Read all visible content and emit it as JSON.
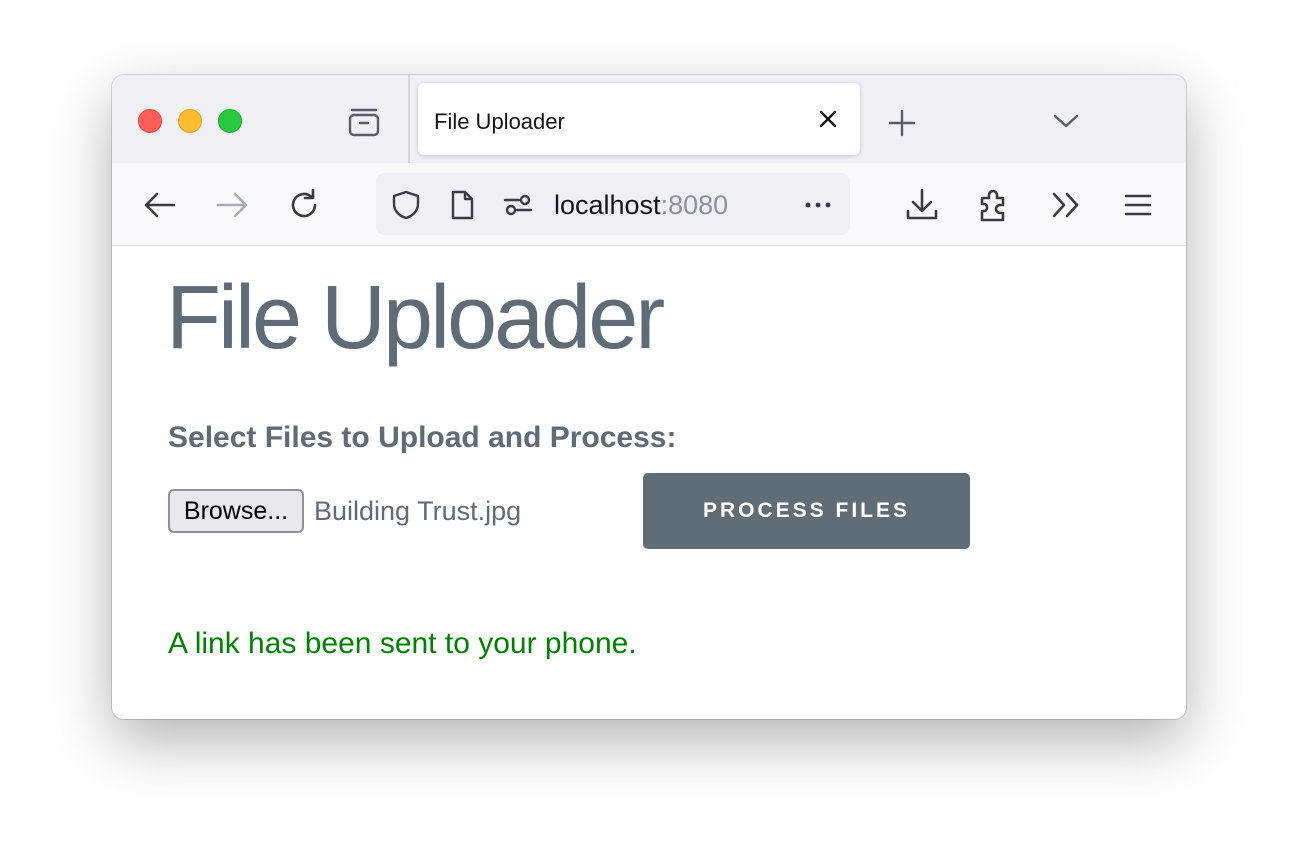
{
  "browser": {
    "tab_title": "File Uploader",
    "url_host": "localhost",
    "url_port": ":8080",
    "icons": {
      "tab_list": "tab-list-icon",
      "tab_close": "close-icon",
      "new_tab": "plus-icon",
      "tab_dropdown": "chevron-down-icon",
      "back": "arrow-left-icon",
      "forward": "arrow-right-icon",
      "reload": "reload-icon",
      "shield": "shield-icon",
      "page": "page-icon",
      "permissions": "permissions-icon",
      "more": "more-icon",
      "downloads": "download-icon",
      "extensions": "puzzle-icon",
      "overflow": "chevrons-right-icon",
      "menu": "hamburger-icon"
    },
    "colors": {
      "tabbar_bg": "#f0f0f4",
      "navbar_bg": "#f9f9fb",
      "close": "#ff5f57",
      "minimize": "#febc2e",
      "zoom": "#28c840"
    }
  },
  "page": {
    "title": "File Uploader",
    "select_label": "Select Files to Upload and Process:",
    "browse_label": "Browse...",
    "selected_file": "Building Trust.jpg",
    "process_label": "PROCESS FILES",
    "status_message": "A link has been sent to your phone.",
    "colors": {
      "text": "#5f6b76",
      "button_bg": "#606c76",
      "status": "#008000"
    }
  }
}
